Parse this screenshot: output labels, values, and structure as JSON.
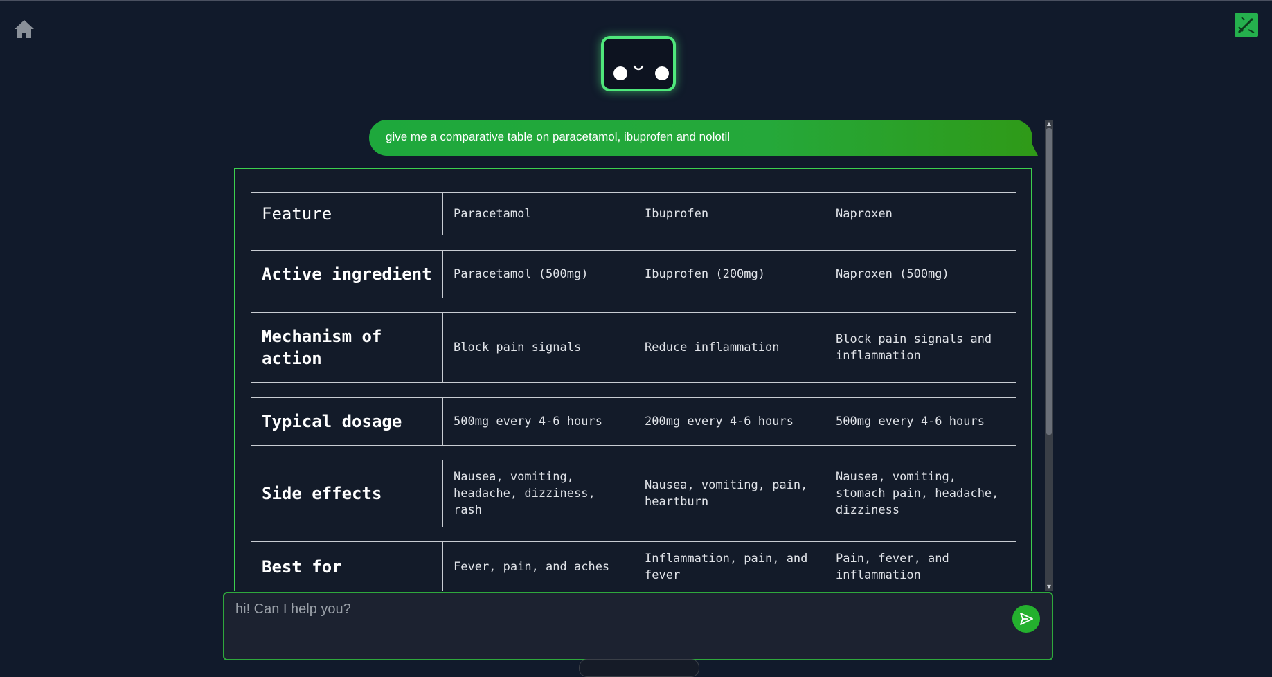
{
  "icons": {
    "home": "home-icon",
    "corner": "edit-icon",
    "send": "send-icon"
  },
  "colors": {
    "accent": "#3ccf4e",
    "background": "#111a2b",
    "user_bubble": "#25a83a"
  },
  "chat": {
    "user_message": "give me a comparative table on paracetamol, ibuprofen and nolotil",
    "table": {
      "header": [
        "Feature",
        "Paracetamol",
        "Ibuprofen",
        "Naproxen"
      ],
      "rows": [
        [
          "Active ingredient",
          "Paracetamol (500mg)",
          "Ibuprofen (200mg)",
          "Naproxen (500mg)"
        ],
        [
          "Mechanism of action",
          "Block pain signals",
          "Reduce inflammation",
          "Block pain signals and inflammation"
        ],
        [
          "Typical dosage",
          "500mg every 4-6 hours",
          "200mg every 4-6 hours",
          "500mg every 4-6 hours"
        ],
        [
          "Side effects",
          "Nausea, vomiting, headache, dizziness, rash",
          "Nausea, vomiting, pain, heartburn",
          "Nausea, vomiting, stomach pain, headache, dizziness"
        ],
        [
          "Best for",
          "Fever, pain, and aches",
          "Inflammation, pain, and fever",
          "Pain, fever, and inflammation"
        ]
      ]
    }
  },
  "input": {
    "placeholder": "hi! Can I help you?",
    "value": ""
  }
}
